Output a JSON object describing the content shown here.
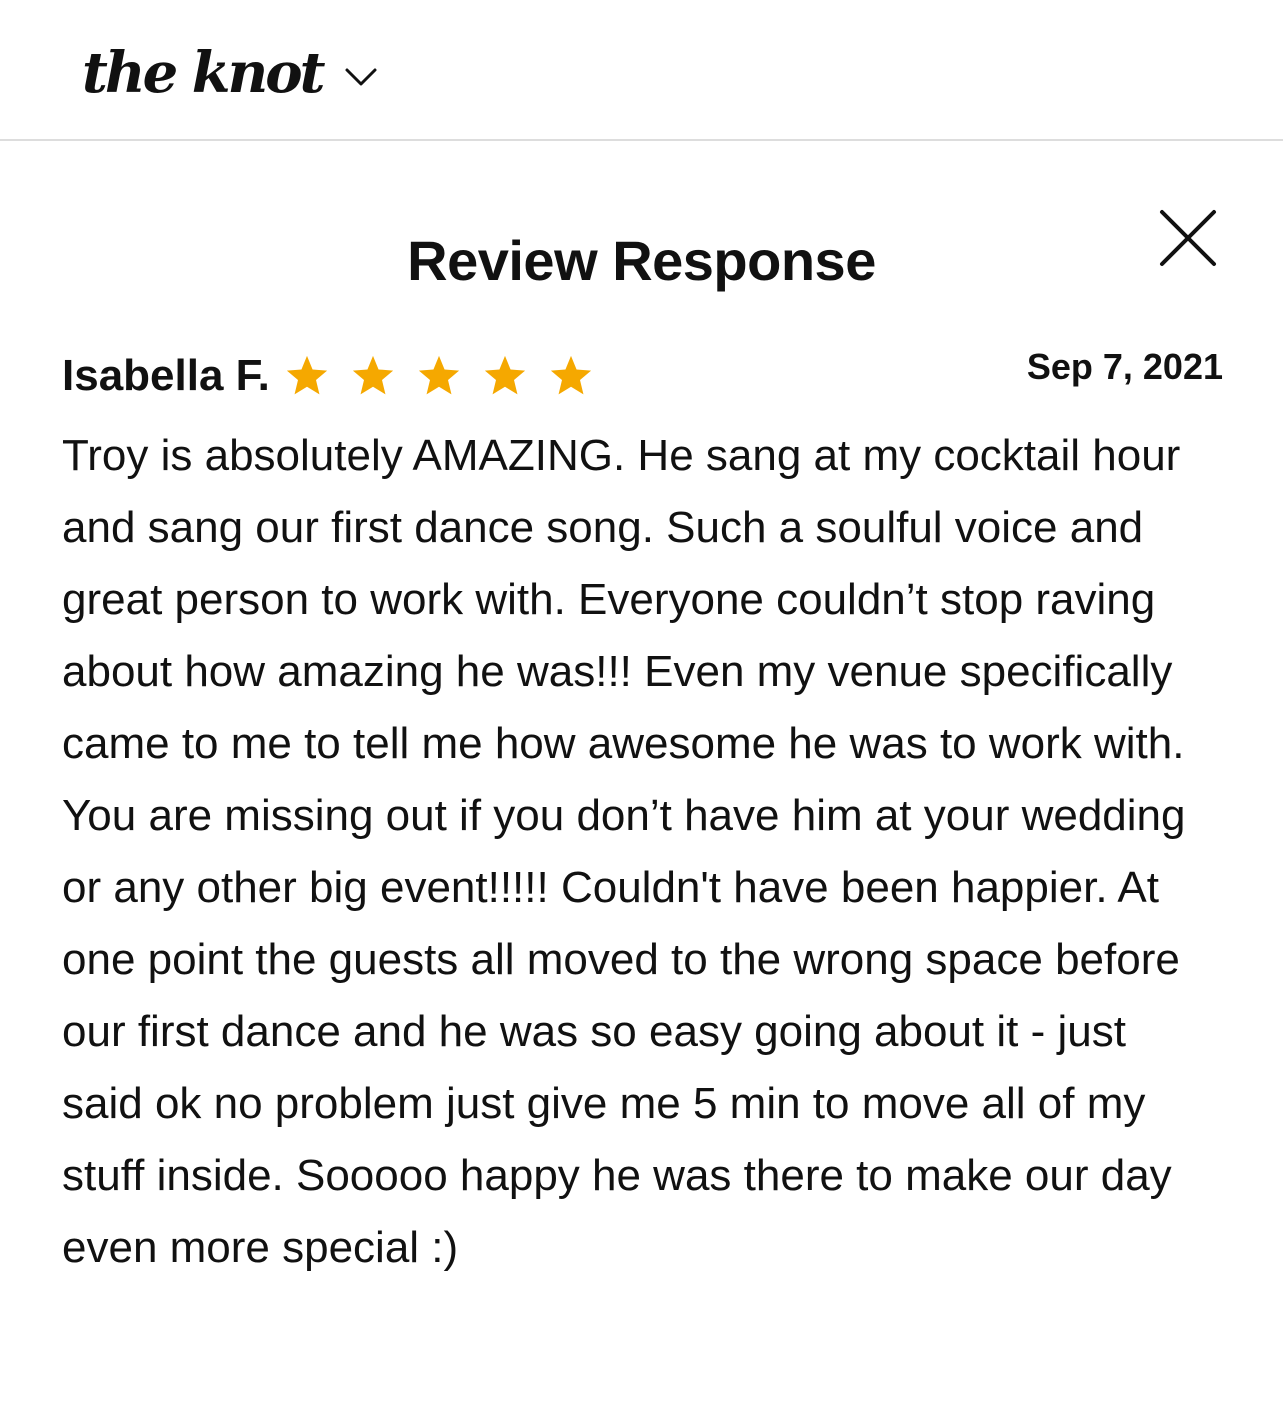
{
  "header": {
    "logo_text": "the knot",
    "logo_icon": "chevron-down-icon"
  },
  "modal": {
    "title": "Review Response",
    "close_icon": "close-icon"
  },
  "review": {
    "author": "Isabella F.",
    "rating": 5,
    "rating_max": 5,
    "date": "Sep 7, 2021",
    "body": "Troy is absolutely AMAZING. He sang at my cocktail hour and sang our first dance song. Such a soulful voice and great person to work with. Everyone couldn’t stop raving about how amazing he was!!! Even my venue specifically came to me to tell me how awesome he was to work with. You are missing out if you don’t have him at your wedding or any other big event!!!!! Couldn't have been happier. At one point the guests all moved to the wrong space before our first dance and he was so easy going about it - just said ok no problem just give me 5 min to move all of my stuff inside. Sooooo happy he was there to make our day even more special :)"
  },
  "colors": {
    "star": "#F5A800",
    "text": "#111111",
    "divider": "#DDDDDD",
    "background": "#FFFFFF"
  }
}
